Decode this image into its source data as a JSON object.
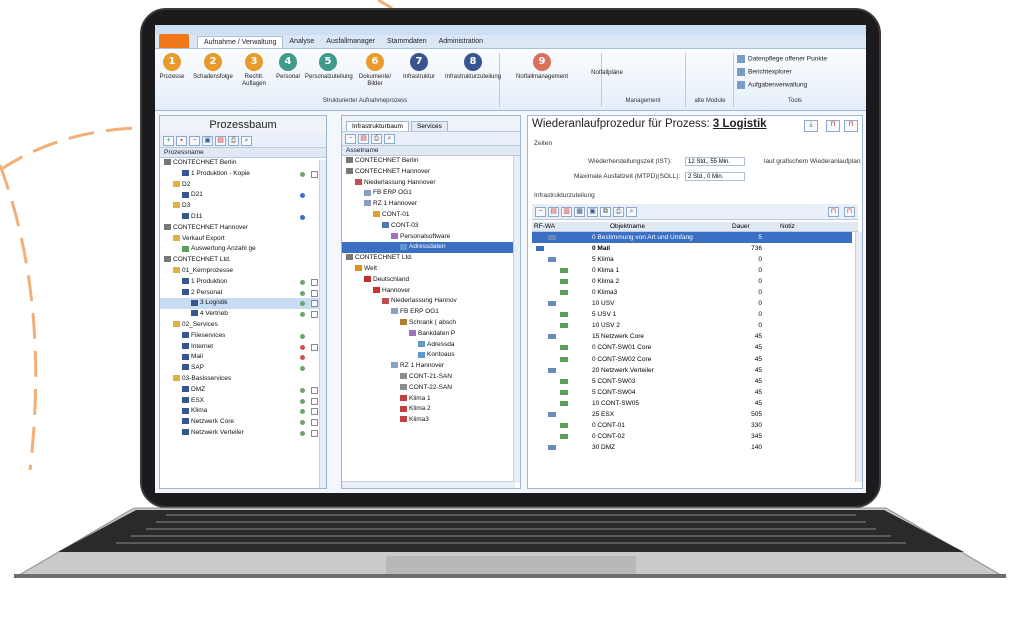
{
  "ribbon": {
    "tabs": [
      "Aufnahme / Verwaltung",
      "Analyse",
      "Ausfallmanager",
      "Stammdaten",
      "Administration"
    ],
    "buttons": [
      {
        "label": "Prozesse",
        "num": "1",
        "color": "#e89a2a"
      },
      {
        "label": "Schadensfolge",
        "num": "2",
        "color": "#e89a2a"
      },
      {
        "label": "Rechtl. Auflagen",
        "num": "3",
        "color": "#e89a2a"
      },
      {
        "label": "Personal",
        "num": "4",
        "color": "#3f9a8a"
      },
      {
        "label": "Personalzuteilung",
        "num": "5",
        "color": "#3f9a8a"
      },
      {
        "label": "Dokumente/ Bilder",
        "num": "6",
        "color": "#e89a2a"
      },
      {
        "label": "Infrastruktur",
        "num": "7",
        "color": "#37568f"
      },
      {
        "label": "Infrastrukturzuteilung",
        "num": "8",
        "color": "#37568f"
      },
      {
        "label": "Notfallmanagement",
        "num": "9",
        "color": "#d9705a"
      },
      {
        "label": "Notfallpläne",
        "num": "",
        "color": ""
      }
    ],
    "groups": [
      "Strukturierter Aufnahmeprozess",
      "Management",
      "alte Module",
      "Tools"
    ],
    "tools": [
      "Datenpflege offener Punkte",
      "Berichtexplorer",
      "Aufgabenverwaltung"
    ]
  },
  "left": {
    "title": "Prozessbaum",
    "column": "Prozessname",
    "rows": [
      {
        "text": "CONTECHNET Berlin",
        "indent": 0,
        "icon": "building"
      },
      {
        "text": "1 Produktion - Kopie",
        "indent": 2,
        "icon": "blue",
        "status": "#6aa86a",
        "doc": true
      },
      {
        "text": "D2",
        "indent": 1,
        "icon": "folder"
      },
      {
        "text": "D21",
        "indent": 2,
        "icon": "blue",
        "status": "#3a6fc4"
      },
      {
        "text": "D3",
        "indent": 1,
        "icon": "folder"
      },
      {
        "text": "D11",
        "indent": 2,
        "icon": "blue",
        "status": "#3a6fc4"
      },
      {
        "text": "CONTECHNET Hannover",
        "indent": 0,
        "icon": "building"
      },
      {
        "text": "Verkauf Export",
        "indent": 1,
        "icon": "folder"
      },
      {
        "text": "Auswertung Anzahl ge",
        "indent": 2,
        "icon": "green"
      },
      {
        "text": "CONTECHNET Ltd.",
        "indent": 0,
        "icon": "building"
      },
      {
        "text": "01_Kernprozesse",
        "indent": 1,
        "icon": "folder"
      },
      {
        "text": "1 Produktion",
        "indent": 2,
        "icon": "blue",
        "status": "#6aa86a",
        "doc": true
      },
      {
        "text": "2 Personal",
        "indent": 2,
        "icon": "blue",
        "status": "#6aa86a",
        "doc": true
      },
      {
        "text": "3 Logistik",
        "indent": 3,
        "icon": "blue",
        "status": "#6aa86a",
        "doc": true,
        "selected": true
      },
      {
        "text": "4 Vertrieb",
        "indent": 3,
        "icon": "blue",
        "status": "#6aa86a",
        "doc": true
      },
      {
        "text": "02_Services",
        "indent": 1,
        "icon": "folder"
      },
      {
        "text": "Fileservices",
        "indent": 2,
        "icon": "arrow",
        "status": "#6aa86a"
      },
      {
        "text": "Internet",
        "indent": 2,
        "icon": "arrow",
        "status": "#d05050",
        "doc": true
      },
      {
        "text": "Mail",
        "indent": 2,
        "icon": "arrow",
        "status": "#d05050"
      },
      {
        "text": "SAP",
        "indent": 2,
        "icon": "arrow",
        "status": "#6aa86a"
      },
      {
        "text": "03-Basisservices",
        "indent": 1,
        "icon": "folder"
      },
      {
        "text": "DMZ",
        "indent": 2,
        "icon": "darrow",
        "status": "#6aa86a",
        "doc": true
      },
      {
        "text": "ESX",
        "indent": 2,
        "icon": "darrow",
        "status": "#6aa86a",
        "doc": true
      },
      {
        "text": "Klima",
        "indent": 2,
        "icon": "darrow",
        "status": "#6aa86a",
        "doc": true
      },
      {
        "text": "Netzwerk Core",
        "indent": 2,
        "icon": "darrow",
        "status": "#6aa86a",
        "doc": true
      },
      {
        "text": "Netzwerk Verteiler",
        "indent": 2,
        "icon": "darrow",
        "status": "#6aa86a",
        "doc": true
      }
    ]
  },
  "middle": {
    "tabs": [
      "Infrastrukturbaum",
      "Services"
    ],
    "column": "Assetname",
    "rows": [
      {
        "text": "CONTECHNET Berlin",
        "indent": 0,
        "icon": "building"
      },
      {
        "text": "CONTECHNET Hannover",
        "indent": 0,
        "icon": "building"
      },
      {
        "text": "Niederlassung Hannover",
        "indent": 1,
        "icon": "house"
      },
      {
        "text": "FB ERP OG1",
        "indent": 2,
        "icon": "rack"
      },
      {
        "text": "RZ 1 Hannover",
        "indent": 2,
        "icon": "rack"
      },
      {
        "text": "CONT-01",
        "indent": 3,
        "icon": "srv"
      },
      {
        "text": "CONT-03",
        "indent": 4,
        "icon": "net"
      },
      {
        "text": "Personalsoftware",
        "indent": 5,
        "icon": "app"
      },
      {
        "text": "Adressdaten",
        "indent": 6,
        "icon": "data",
        "selected": true
      },
      {
        "text": "CONTECHNET Ltd.",
        "indent": 0,
        "icon": "building"
      },
      {
        "text": "Welt",
        "indent": 1,
        "icon": "globe"
      },
      {
        "text": "Deutschland",
        "indent": 2,
        "icon": "flag"
      },
      {
        "text": "Hannover",
        "indent": 3,
        "icon": "pin"
      },
      {
        "text": "Niederlassung Hannov",
        "indent": 4,
        "icon": "house"
      },
      {
        "text": "FB ERP OG1",
        "indent": 5,
        "icon": "rack"
      },
      {
        "text": "Schrank ( absch",
        "indent": 6,
        "icon": "lock"
      },
      {
        "text": "Bankdaten P",
        "indent": 7,
        "icon": "app"
      },
      {
        "text": "Adressda",
        "indent": 8,
        "icon": "data"
      },
      {
        "text": "Kontoaus",
        "indent": 8,
        "icon": "data"
      },
      {
        "text": "RZ 1 Hannover",
        "indent": 5,
        "icon": "rack"
      },
      {
        "text": "CONT-21-SAN",
        "indent": 6,
        "icon": "disk"
      },
      {
        "text": "CONT-22-SAN",
        "indent": 6,
        "icon": "disk"
      },
      {
        "text": "Klima 1",
        "indent": 6,
        "icon": "red"
      },
      {
        "text": "Klima 2",
        "indent": 6,
        "icon": "red"
      },
      {
        "text": "Klima3",
        "indent": 6,
        "icon": "red"
      }
    ]
  },
  "right": {
    "heading": "Wiederanlaufprozedur für Prozess:",
    "process": "3 Logistik",
    "section_zeiten": "Zeiten",
    "ist_label": "Wiederherstellungszeit (IST):",
    "ist_value": "12 Std., 55 Min.",
    "ist_note": "laut grafischem Wiederanlaufplan",
    "soll_label": "Maximale Ausfallzeit (MTPD)(SOLL):",
    "soll_value": "2 Std., 0 Min.",
    "section_infra": "Infrastrukturzuteilung",
    "columns": [
      "RF-WA",
      "Objektname",
      "Dauer",
      "Notiz"
    ],
    "rows": [
      {
        "text": "0 Bestimmung von Art und Umfang",
        "dauer": "5",
        "indent": 1,
        "selected": true
      },
      {
        "text": "0 Mail",
        "dauer": "736",
        "indent": 0,
        "bold": true
      },
      {
        "text": "5 Klima",
        "dauer": "0",
        "indent": 1
      },
      {
        "text": "0 Klima 1",
        "dauer": "0",
        "indent": 2
      },
      {
        "text": "0 Klima 2",
        "dauer": "0",
        "indent": 2
      },
      {
        "text": "0 Klima3",
        "dauer": "0",
        "indent": 2
      },
      {
        "text": "10 USV",
        "dauer": "0",
        "indent": 1
      },
      {
        "text": "5 USV 1",
        "dauer": "0",
        "indent": 2
      },
      {
        "text": "10 USV 2",
        "dauer": "0",
        "indent": 2
      },
      {
        "text": "15 Netzwerk Core",
        "dauer": "45",
        "indent": 1
      },
      {
        "text": "0 CONT-SW01 Core",
        "dauer": "45",
        "indent": 2
      },
      {
        "text": "0 CONT-SW02 Core",
        "dauer": "45",
        "indent": 2
      },
      {
        "text": "20 Netzwerk Verteiler",
        "dauer": "45",
        "indent": 1
      },
      {
        "text": "5 CONT-SW03",
        "dauer": "45",
        "indent": 2
      },
      {
        "text": "5 CONT-SW04",
        "dauer": "45",
        "indent": 2
      },
      {
        "text": "10 CONT-SW05",
        "dauer": "45",
        "indent": 2
      },
      {
        "text": "25 ESX",
        "dauer": "505",
        "indent": 1
      },
      {
        "text": "0 CONT-01",
        "dauer": "330",
        "indent": 2
      },
      {
        "text": "0 CONT-02",
        "dauer": "345",
        "indent": 2
      },
      {
        "text": "30 DMZ",
        "dauer": "140",
        "indent": 1
      }
    ]
  }
}
